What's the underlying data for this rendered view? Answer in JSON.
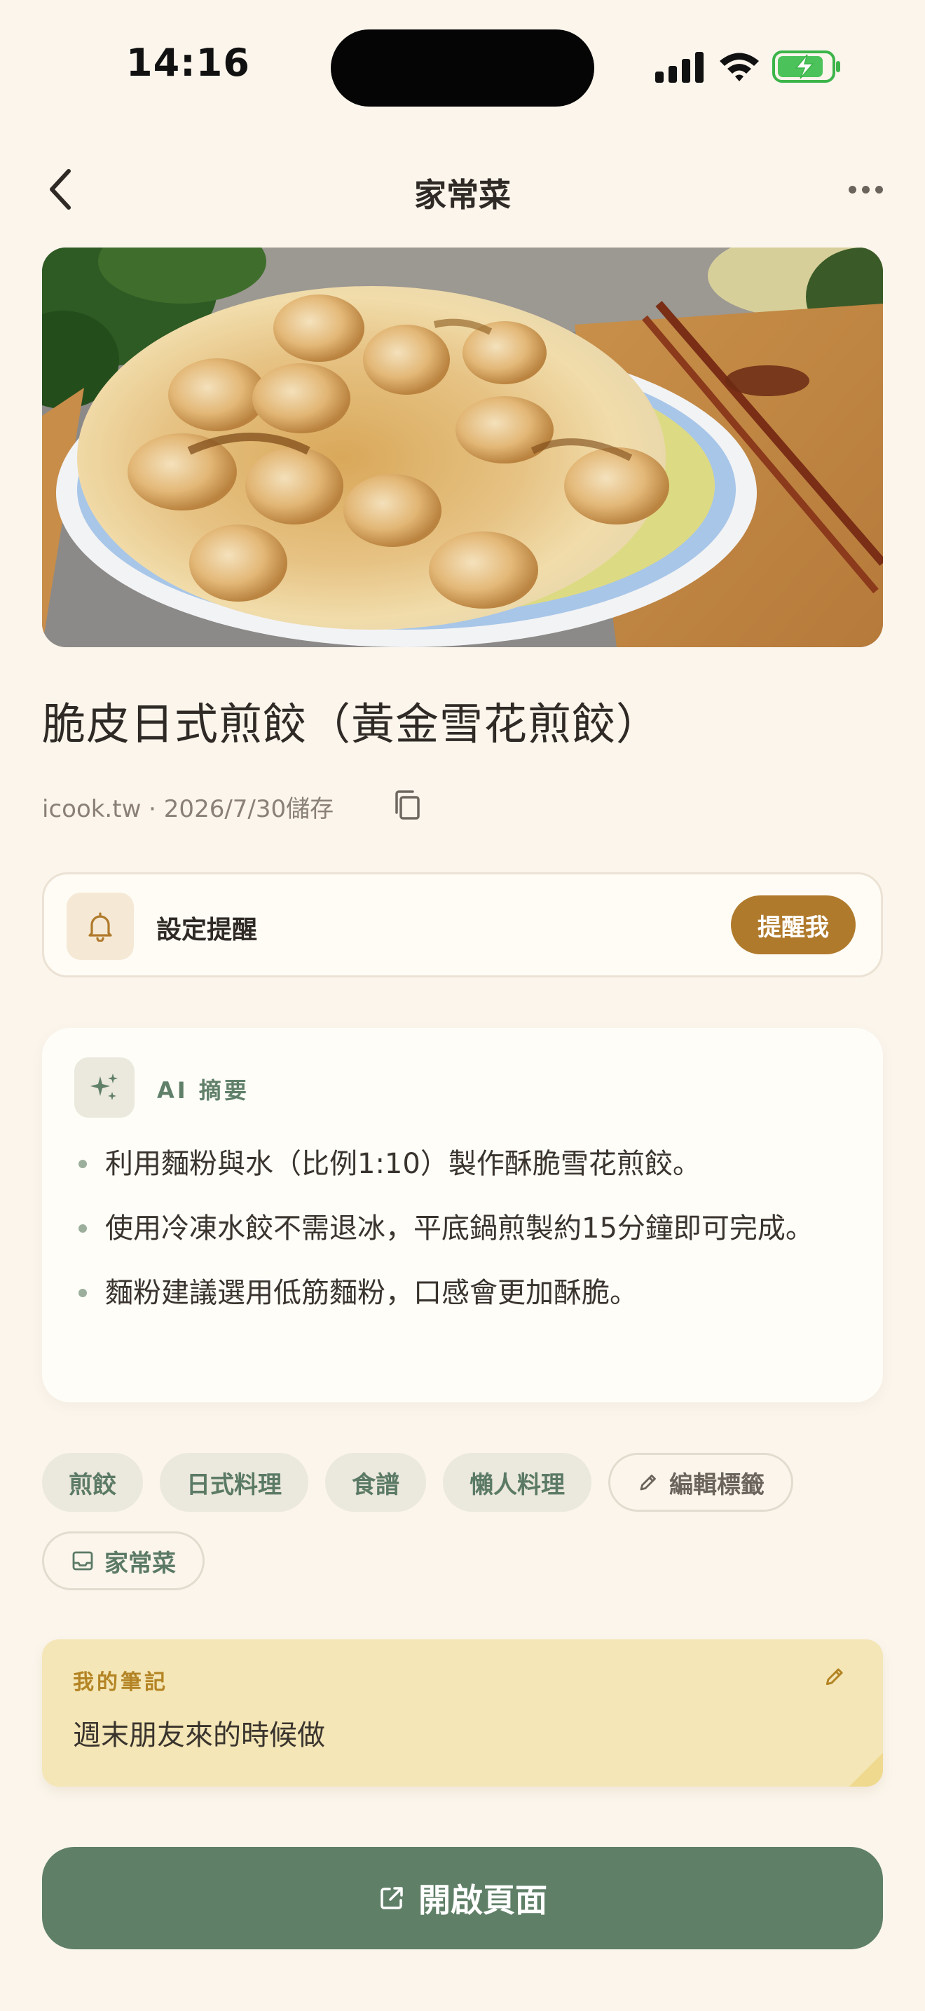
{
  "status_bar": {
    "time": "14:16"
  },
  "nav": {
    "title": "家常菜",
    "back_icon": "chevron-left-icon",
    "more_icon": "more-horizontal-icon"
  },
  "recipe": {
    "title": "脆皮日式煎餃（黃金雪花煎餃）",
    "meta": "icook.tw · 2026/7/30儲存",
    "hero_image": "crispy-gyoza-photo"
  },
  "reminder": {
    "label": "設定提醒",
    "button": "提醒我"
  },
  "ai_summary": {
    "title": "AI 摘要",
    "points": [
      "利用麵粉與水（比例1:10）製作酥脆雪花煎餃。",
      "使用冷凍水餃不需退冰，平底鍋煎製約15分鐘即可完成。",
      "麵粉建議選用低筋麵粉，口感會更加酥脆。"
    ]
  },
  "tags": {
    "items": [
      "煎餃",
      "日式料理",
      "食譜",
      "懶人料理"
    ],
    "edit_label": "編輯標籤",
    "folder_label": "家常菜"
  },
  "note": {
    "title": "我的筆記",
    "text": "週末朋友來的時候做"
  },
  "footer": {
    "open_label": "開啟頁面"
  },
  "colors": {
    "background": "#fbf5ec",
    "accent_gold": "#b07a2c",
    "accent_green": "#5f7f67",
    "tag_bg": "#ebe8dd",
    "note_bg": "#f4e6b6"
  }
}
